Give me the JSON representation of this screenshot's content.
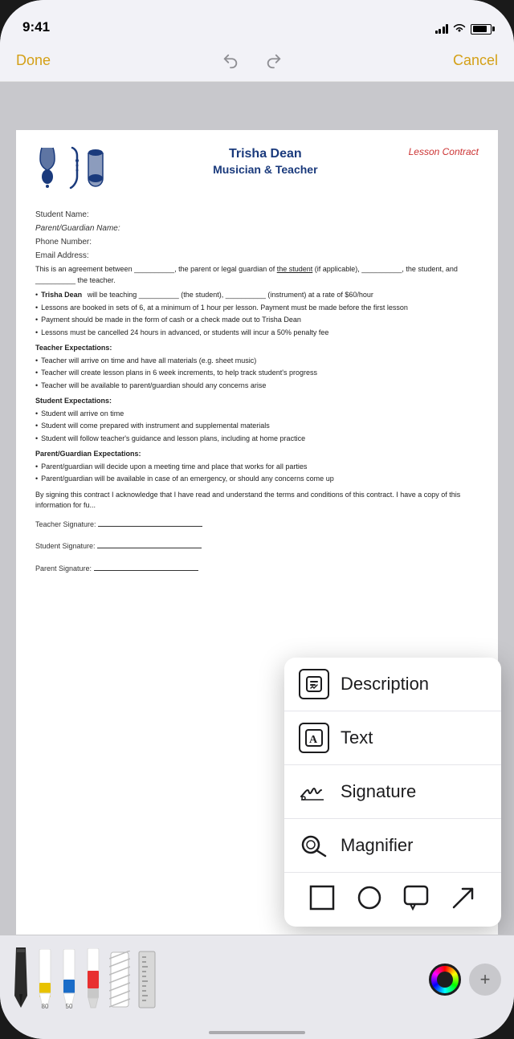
{
  "status": {
    "time": "9:41"
  },
  "nav": {
    "done_label": "Done",
    "cancel_label": "Cancel"
  },
  "document": {
    "header": {
      "musician_name": "Trisha Dean",
      "musician_subtitle": "Musician & Teacher",
      "contract_label": "Lesson Contract"
    },
    "fields": [
      {
        "label": "Student Name:"
      },
      {
        "label": "Parent/Guardian Name:",
        "italic": true
      },
      {
        "label": "Phone Number:"
      },
      {
        "label": "Email Address:"
      }
    ],
    "agreement_text": "This is an agreement between __________, the parent or legal guardian of the student (if applicable), __________, the student, and __________ the teacher.",
    "bullets": [
      "Trisha Dean will be teaching __________ (the student), __________ (instrument) at a rate of $60/hour",
      "Lessons are booked in sets of 6, at a minimum of 1 hour per lesson. Payment must be made before the first lesson",
      "Payment should be made in the form of cash or a check made out to Trisha Dean",
      "Lessons must be cancelled 24 hours in advanced, or students will incur a 50% penalty fee"
    ],
    "teacher_expectations_title": "Teacher Expectations:",
    "teacher_bullets": [
      "Teacher will arrive on time and have all materials (e.g. sheet music)",
      "Teacher will create lesson plans in 6 week increments, to help track student's progress",
      "Teacher will be available to parent/guardian should any concerns arise"
    ],
    "student_expectations_title": "Student Expectations:",
    "student_bullets": [
      "Student will arrive on time",
      "Student will come prepared with instrument and supplemental materials",
      "Student will follow teacher's guidance and lesson plans, including at home practice"
    ],
    "parent_expectations_title": "Parent/Guardian Expectations:",
    "parent_bullets": [
      "Parent/guardian will decide upon a meeting time and place that works for all parties",
      "Parent/guardian will be available in case of an emergency, or should any concerns come up"
    ],
    "closing_text": "By signing this contract I acknowledge that I have read and understand the terms and conditions of this contract. I have a copy of this information for fu...",
    "signatures": [
      {
        "label": "Teacher Signature: "
      },
      {
        "label": "Student Signature: "
      },
      {
        "label": "Parent Signature: "
      }
    ]
  },
  "context_menu": {
    "items": [
      {
        "id": "description",
        "label": "Description",
        "icon_type": "speech-bubble"
      },
      {
        "id": "text",
        "label": "Text",
        "icon_type": "text-box"
      },
      {
        "id": "signature",
        "label": "Signature",
        "icon_type": "signature"
      },
      {
        "id": "magnifier",
        "label": "Magnifier",
        "icon_type": "magnifier"
      }
    ],
    "shapes": [
      {
        "id": "square",
        "shape": "square"
      },
      {
        "id": "circle",
        "shape": "circle"
      },
      {
        "id": "speech",
        "shape": "speech"
      },
      {
        "id": "arrow",
        "shape": "arrow"
      }
    ]
  },
  "toolbar": {
    "tools": [
      {
        "id": "pen-black",
        "label": ""
      },
      {
        "id": "pen-yellow",
        "label": "80"
      },
      {
        "id": "pen-blue",
        "label": "50"
      },
      {
        "id": "pen-red",
        "label": ""
      }
    ],
    "add_label": "+"
  }
}
